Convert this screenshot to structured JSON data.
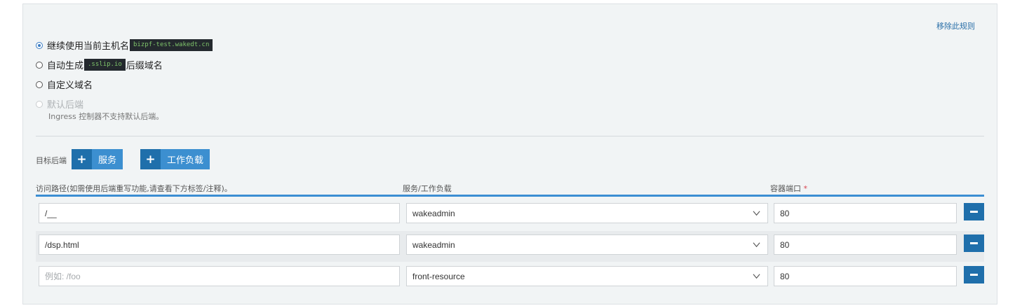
{
  "rule": {
    "remove_label": "移除此规则"
  },
  "hostname_options": [
    {
      "label_before": "继续使用当前主机名",
      "chip": "bizpf-test.wakedt.cn",
      "label_after": "",
      "checked": true,
      "disabled": false
    },
    {
      "label_before": "自动生成",
      "chip": ".sslip.io",
      "label_after": "后缀域名",
      "checked": false,
      "disabled": false
    },
    {
      "label_before": "自定义域名",
      "chip": "",
      "label_after": "",
      "checked": false,
      "disabled": false
    },
    {
      "label_before": "默认后端",
      "chip": "",
      "label_after": "",
      "checked": false,
      "disabled": true
    }
  ],
  "default_backend_help": "Ingress 控制器不支持默认后端。",
  "targets": {
    "label": "目标后端",
    "add_service": "服务",
    "add_workload": "工作负载"
  },
  "columns": {
    "path": "访问路径(如需使用后端重写功能,请查看下方标签/注释)。",
    "target": "服务/工作负载",
    "port": "容器端口",
    "required_mark": "*"
  },
  "rows": [
    {
      "path": "/__",
      "path_placeholder": "例如: /foo",
      "target": "wakeadmin",
      "port": "80"
    },
    {
      "path": "/dsp.html",
      "path_placeholder": "例如: /foo",
      "target": "wakeadmin",
      "port": "80"
    },
    {
      "path": "",
      "path_placeholder": "例如: /foo",
      "target": "front-resource",
      "port": "80"
    }
  ]
}
